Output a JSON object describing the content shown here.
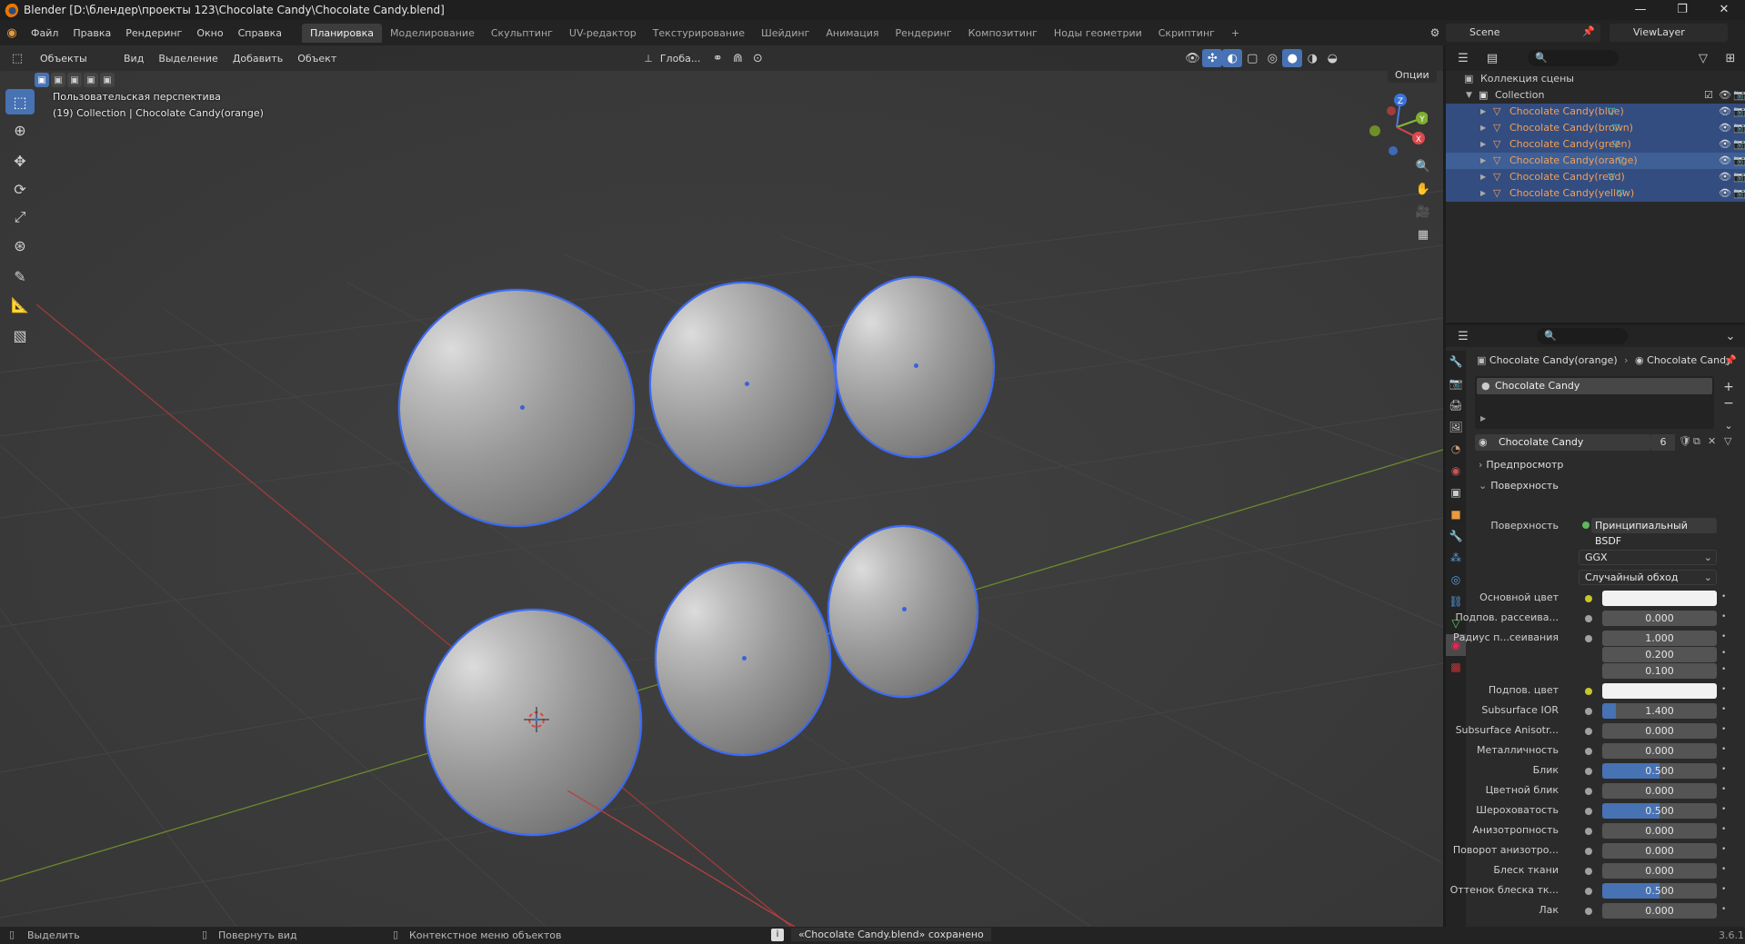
{
  "window": {
    "title": "Blender [D:\\блендер\\проекты 123\\Chocolate Candy\\Chocolate Candy.blend]",
    "min": "—",
    "max": "❐",
    "close": "✕"
  },
  "topmenu": [
    "Файл",
    "Правка",
    "Рендеринг",
    "Окно",
    "Справка"
  ],
  "workspaces": [
    "Планировка",
    "Моделирование",
    "Скульптинг",
    "UV-редактор",
    "Текстурирование",
    "Шейдинг",
    "Анимация",
    "Рендеринг",
    "Композитинг",
    "Ноды геометрии",
    "Скриптинг"
  ],
  "workspace_add": "+",
  "scene": "Scene",
  "viewlayer": "ViewLayer",
  "viewport": {
    "mode": "Объекты",
    "menus": [
      "Вид",
      "Выделение",
      "Добавить",
      "Объект"
    ],
    "transform_orientation": "Глоба...",
    "options": "Опции",
    "info_line1": "Пользовательская перспектива",
    "info_line2": "(19) Collection | Chocolate Candy(orange)",
    "gizmo_z": "Z",
    "gizmo_y": "Y",
    "gizmo_x": "X"
  },
  "outliner": {
    "root": "Коллекция сцены",
    "collection": "Collection",
    "objects": [
      "Chocolate Candy(blue)",
      "Chocolate Candy(brown)",
      "Chocolate Candy(green)",
      "Chocolate Candy(orange)",
      "Chocolate Candy(read)",
      "Chocolate Candy(yellow)"
    ],
    "active": "Chocolate Candy(orange)"
  },
  "properties": {
    "breadcrumb_object": "Chocolate Candy(orange)",
    "breadcrumb_material": "Chocolate Candy",
    "slot": "Chocolate Candy",
    "material_name": "Chocolate Candy",
    "users": "6",
    "panel_preview": "Предпросмотр",
    "panel_surface": "Поверхность",
    "surface_label": "Поверхность",
    "surface_value": "Принципиальный BSDF",
    "distribution": "GGX",
    "subsurface_method": "Случайный обход",
    "rows": [
      {
        "label": "Основной цвет",
        "value": "",
        "kind": "color"
      },
      {
        "label": "Подпов. рассеива...",
        "value": "0.000",
        "kind": "num",
        "fill": 0
      },
      {
        "label": "Радиус п...сеивания",
        "value": "1.000",
        "kind": "num",
        "fill": 0
      },
      {
        "label": "",
        "value": "0.200",
        "kind": "num",
        "fill": 0
      },
      {
        "label": "",
        "value": "0.100",
        "kind": "num",
        "fill": 0
      },
      {
        "label": "Подпов. цвет",
        "value": "",
        "kind": "color"
      },
      {
        "label": "Subsurface IOR",
        "value": "1.400",
        "kind": "num",
        "fill": 0.12
      },
      {
        "label": "Subsurface Anisotr...",
        "value": "0.000",
        "kind": "num",
        "fill": 0
      },
      {
        "label": "Металличность",
        "value": "0.000",
        "kind": "num",
        "fill": 0
      },
      {
        "label": "Блик",
        "value": "0.500",
        "kind": "num",
        "fill": 0.5
      },
      {
        "label": "Цветной блик",
        "value": "0.000",
        "kind": "num",
        "fill": 0
      },
      {
        "label": "Шероховатость",
        "value": "0.500",
        "kind": "num",
        "fill": 0.5
      },
      {
        "label": "Анизотропность",
        "value": "0.000",
        "kind": "num",
        "fill": 0
      },
      {
        "label": "Поворот анизотро...",
        "value": "0.000",
        "kind": "num",
        "fill": 0
      },
      {
        "label": "Блеск ткани",
        "value": "0.000",
        "kind": "num",
        "fill": 0
      },
      {
        "label": "Оттенок блеска тк...",
        "value": "0.500",
        "kind": "num",
        "fill": 0.5
      },
      {
        "label": "Лак",
        "value": "0.000",
        "kind": "num",
        "fill": 0
      }
    ]
  },
  "status": {
    "select": "Выделить",
    "rotate": "Повернуть вид",
    "context": "Контекстное меню объектов",
    "message": "«Chocolate Candy.blend» сохранено",
    "version": "3.6.1"
  },
  "colors": {
    "accent": "#4772b3",
    "selection_outline": "#3d6cff",
    "object_orange": "#f0a05a",
    "active_row": "#3f5f97"
  }
}
